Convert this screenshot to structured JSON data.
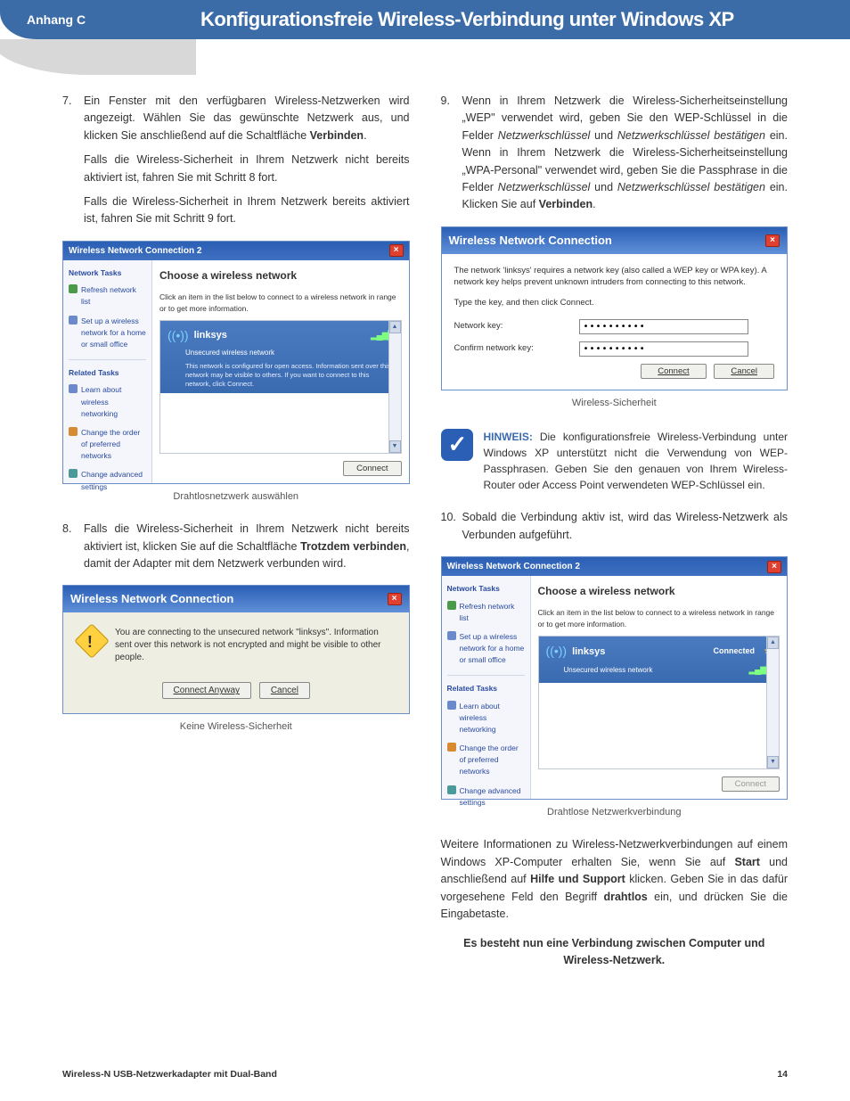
{
  "header": {
    "appendix": "Anhang C",
    "title": "Konfigurationsfreie Wireless-Verbindung unter Windows XP"
  },
  "left": {
    "step7": {
      "num": "7.",
      "text_a": "Ein Fenster mit den verfügbaren Wireless-Netzwerken wird angezeigt. Wählen Sie das gewünschte Netzwerk aus, und klicken Sie anschließend auf die Schaltfläche ",
      "text_b_bold": "Verbinden",
      "text_c": ".",
      "sub1": "Falls die Wireless-Sicherheit in Ihrem Netzwerk nicht bereits aktiviert ist, fahren Sie mit Schritt 8 fort.",
      "sub2": "Falls die Wireless-Sicherheit in Ihrem Netzwerk bereits aktiviert ist, fahren Sie mit Schritt 9 fort."
    },
    "shot1": {
      "title": "Wireless Network Connection 2",
      "side_head": "Network Tasks",
      "side_refresh": "Refresh network list",
      "side_setup": "Set up a wireless network for a home or small office",
      "rel_head": "Related Tasks",
      "rel_learn": "Learn about wireless networking",
      "rel_order": "Change the order of preferred networks",
      "rel_adv": "Change advanced settings",
      "main_head": "Choose a wireless network",
      "main_sub": "Click an item in the list below to connect to a wireless network in range or to get more information.",
      "net_name": "linksys",
      "net_sub": "Unsecured wireless network",
      "net_desc": "This network is configured for open access. Information sent over this network may be visible to others. If you want to connect to this network, click Connect.",
      "connect": "Connect",
      "caption": "Drahtlosnetzwerk auswählen"
    },
    "step8": {
      "num": "8.",
      "text_a": "Falls die Wireless-Sicherheit in Ihrem Netzwerk nicht bereits aktiviert ist, klicken Sie auf die Schaltfläche ",
      "text_b_bold": "Trotzdem verbinden",
      "text_c": ", damit der Adapter mit dem Netzwerk verbunden wird."
    },
    "shot2": {
      "title": "Wireless Network Connection",
      "msg": "You are connecting to the unsecured network \"linksys\". Information sent over this network is not encrypted and might be visible to other people.",
      "btn1": "Connect Anyway",
      "btn2": "Cancel",
      "caption": "Keine Wireless-Sicherheit"
    }
  },
  "right": {
    "step9": {
      "num": "9.",
      "text_a": "Wenn in Ihrem Netzwerk die Wireless-Sicherheitseinstellung „WEP\" verwendet wird, geben Sie den WEP-Schlüssel in die Felder ",
      "text_b_it": "Netzwerkschlüssel",
      "text_c": " und ",
      "text_d_it": "Netzwerkschlüssel bestätigen",
      "text_e": " ein. Wenn in Ihrem Netzwerk die Wireless-Sicherheitseinstellung „WPA-Personal\" verwendet wird, geben Sie die Passphrase in die Felder ",
      "text_f_it": "Netzwerkschlüssel",
      "text_g": " und ",
      "text_h_it": "Netzwerkschlüssel bestätigen",
      "text_i": " ein. Klicken Sie auf ",
      "text_j_bold": "Verbinden",
      "text_k": "."
    },
    "shot3": {
      "title": "Wireless Network Connection",
      "msg": "The network 'linksys' requires a network key (also called a WEP key or WPA key). A network key helps prevent unknown intruders from connecting to this network.",
      "sub": "Type the key, and then click Connect.",
      "lbl1": "Network key:",
      "lbl2": "Confirm network key:",
      "val": "••••••••••",
      "btn1": "Connect",
      "btn2": "Cancel",
      "caption": "Wireless-Sicherheit"
    },
    "hinweis": {
      "label": "HINWEIS:",
      "text": " Die konfigurationsfreie Wireless-Verbindung unter Windows XP unterstützt nicht die Verwendung von WEP-Passphrasen. Geben Sie den genauen von Ihrem Wireless-Router oder Access Point verwendeten WEP-Schlüssel ein."
    },
    "step10": {
      "num": "10.",
      "text": "Sobald die Verbindung aktiv ist, wird das Wireless-Netzwerk als Verbunden aufgeführt."
    },
    "shot4": {
      "title": "Wireless Network Connection 2",
      "status": "Connected",
      "connect": "Connect",
      "caption": "Drahtlose Netzwerkverbindung"
    },
    "outro_a": "Weitere Informationen zu Wireless-Netzwerkverbindungen auf einem Windows XP-Computer erhalten Sie, wenn Sie auf ",
    "outro_b_bold": "Start",
    "outro_c": " und anschließend auf ",
    "outro_d_bold": "Hilfe und Support",
    "outro_e": " klicken. Geben Sie in das dafür vorgesehene Feld den Begriff ",
    "outro_f_bold": "drahtlos",
    "outro_g": " ein, und drücken Sie die Eingabetaste.",
    "final": "Es besteht nun eine Verbindung zwischen Computer und Wireless-Netzwerk."
  },
  "footer": {
    "product": "Wireless-N USB-Netzwerkadapter mit Dual-Band",
    "page": "14"
  }
}
